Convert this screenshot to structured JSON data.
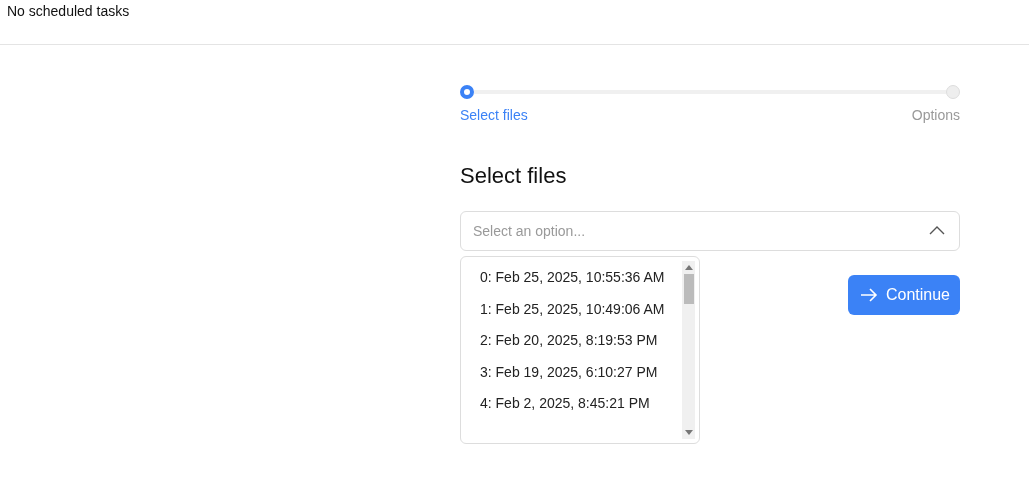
{
  "header": {
    "text": "No scheduled tasks"
  },
  "steps": [
    {
      "label": "Select files",
      "selected": true
    },
    {
      "label": "Options",
      "selected": false
    }
  ],
  "heading": "Select files",
  "select": {
    "placeholder": "Select an option...",
    "expanded": true,
    "options": [
      "0: Feb 25, 2025, 10:55:36 AM",
      "1: Feb 25, 2025, 10:49:06 AM",
      "2: Feb 20, 2025, 8:19:53 PM",
      "3: Feb 19, 2025, 6:10:27 PM",
      "4: Feb 2, 2025, 8:45:21 PM"
    ]
  },
  "button": {
    "label": "Continue"
  }
}
